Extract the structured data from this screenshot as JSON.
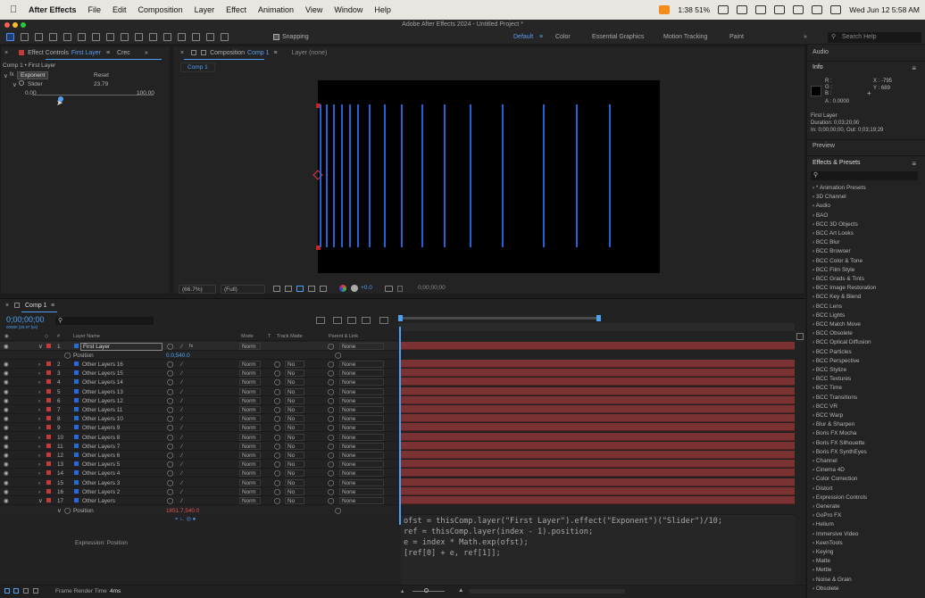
{
  "menubar": {
    "app": "After Effects",
    "items": [
      "File",
      "Edit",
      "Composition",
      "Layer",
      "Effect",
      "Animation",
      "View",
      "Window",
      "Help"
    ],
    "battery_text": "1:38 51%",
    "clock": "Wed Jun 12  5:58 AM"
  },
  "title": "Adobe After Effects 2024 - Untitled Project *",
  "toolbar": {
    "snapping": "Snapping",
    "workspaces": [
      "Default",
      "Color",
      "Essential Graphics",
      "Motion Tracking",
      "Paint"
    ],
    "search_placeholder": "Search Help"
  },
  "effect_controls": {
    "tab_label": "Effect Controls",
    "layer": "First Layer",
    "other_tab": "Crec",
    "breadcrumb": "Comp 1 • First Layer",
    "effect_name": "Exponent",
    "reset": "Reset",
    "param": "Slider",
    "param_value": "23.79",
    "min": "0.00",
    "max": "100.00",
    "slider_fraction": 0.2379
  },
  "composition": {
    "tab_label": "Composition",
    "comp_name": "Comp 1",
    "layer_tab": "Layer (none)",
    "breadcrumb": "Comp 1",
    "zoom": "(66.7%)",
    "resolution": "(Full)",
    "exposure": "+0.0",
    "timecode": "0;00;00;00"
  },
  "right": {
    "audio": "Audio",
    "info": "Info",
    "rgb": [
      "R :",
      "G :",
      "B :",
      "A :  0.0000"
    ],
    "xy": [
      "X : -795",
      "Y :  689"
    ],
    "info_layer": "First Layer",
    "duration": "Duration: 0;03;20;00",
    "inout": "In: 0;00;00;00, Out: 0;03;19;29",
    "preview": "Preview",
    "effects_presets": "Effects & Presets",
    "categories": [
      "* Animation Presets",
      "3D Channel",
      "Audio",
      "BAO",
      "BCC 3D Objects",
      "BCC Art Looks",
      "BCC Blur",
      "BCC Browser",
      "BCC Color & Tone",
      "BCC Film Style",
      "BCC Grads & Tints",
      "BCC Image Restoration",
      "BCC Key & Blend",
      "BCC Lens",
      "BCC Lights",
      "BCC Match Move",
      "BCC Obsolete",
      "BCC Optical Diffusion",
      "BCC Particles",
      "BCC Perspective",
      "BCC Stylize",
      "BCC Textures",
      "BCC Time",
      "BCC Transitions",
      "BCC VR",
      "BCC Warp",
      "Blur & Sharpen",
      "Boris FX Mocha",
      "Boris FX Silhouette",
      "Boris FX SynthEyes",
      "Channel",
      "Cinema 4D",
      "Color Correction",
      "Distort",
      "Expression Controls",
      "Generate",
      "GoPro FX",
      "Helium",
      "Immersive Video",
      "KeenTools",
      "Keying",
      "Matte",
      "Mettle",
      "Noise & Grain",
      "Obsolete"
    ]
  },
  "timeline": {
    "tab": "Comp 1",
    "timecode": "0;00;00;00",
    "fps": "00000 (29.97 fps)",
    "col_headers": {
      "layer_name": "Layer Name",
      "mode": "Mode",
      "t": "T",
      "track_matte": "Track Matte",
      "parent": "Parent & Link"
    },
    "ruler": [
      "0s",
      "00:15s",
      "00:30s",
      "00:45s",
      "01:00s",
      "01:15s",
      "01:30s"
    ],
    "first_layer": {
      "num": "1",
      "name": "First Layer",
      "mode": "Norm",
      "parent": "None"
    },
    "position_label": "Position",
    "position_value": "0.0,540.0",
    "layers": [
      {
        "num": "2",
        "name": "Other Layers 16"
      },
      {
        "num": "3",
        "name": "Other Layers 15"
      },
      {
        "num": "4",
        "name": "Other Layers 14"
      },
      {
        "num": "5",
        "name": "Other Layers 13"
      },
      {
        "num": "6",
        "name": "Other Layers 12"
      },
      {
        "num": "7",
        "name": "Other Layers 11"
      },
      {
        "num": "8",
        "name": "Other Layers 10"
      },
      {
        "num": "9",
        "name": "Other Layers 9"
      },
      {
        "num": "10",
        "name": "Other Layers 8"
      },
      {
        "num": "11",
        "name": "Other Layers 7"
      },
      {
        "num": "12",
        "name": "Other Layers 6"
      },
      {
        "num": "13",
        "name": "Other Layers 5"
      },
      {
        "num": "14",
        "name": "Other Layers 4"
      },
      {
        "num": "15",
        "name": "Other Layers 3"
      },
      {
        "num": "16",
        "name": "Other Layers 2"
      },
      {
        "num": "17",
        "name": "Other Layers"
      }
    ],
    "layer_mode": "Norm",
    "layer_matte": "No",
    "layer_parent": "None",
    "position2_label": "Position",
    "position2_value": "1851.7,540.0",
    "expression_label": "Expression: Position",
    "code": [
      "ofst = thisComp.layer(\"First Layer\").effect(\"Exponent\")(\"Slider\")/10;",
      "ref = thisComp.layer(index - 1).position;",
      "e = index * Math.exp(ofst);",
      "[ref[0] + e, ref[1]];"
    ],
    "frame_render_label": "Frame Render Time",
    "frame_render_value": "4ms"
  },
  "colors": {
    "accent": "#4ea0f5",
    "layer_label": "#c43b3b",
    "line_blue": "#2563d8",
    "bar_red": "#7a3232"
  }
}
